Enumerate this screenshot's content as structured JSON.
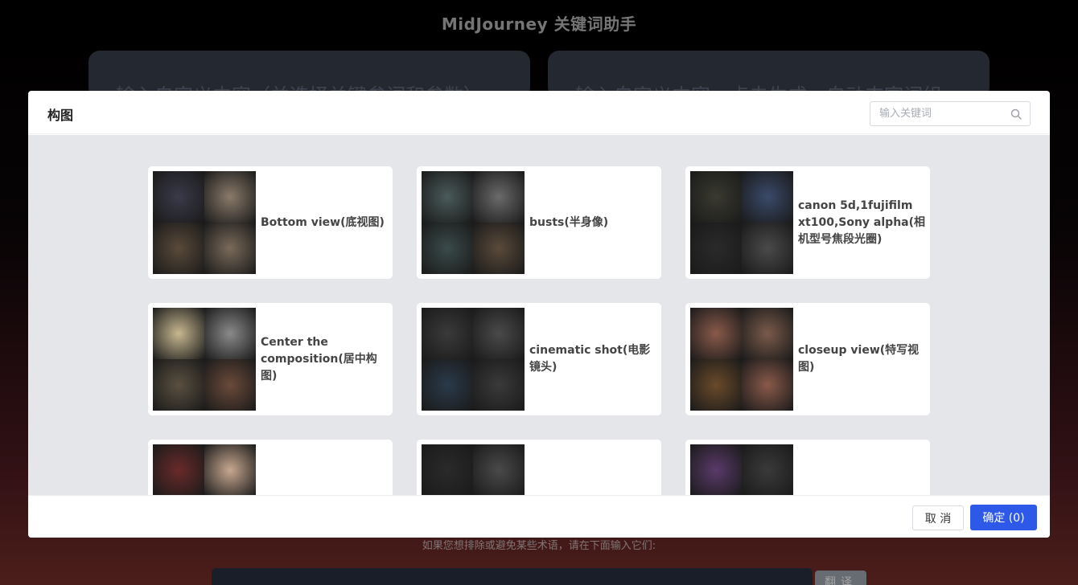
{
  "page": {
    "title": "MidJourney 关键词助手",
    "panel_left_text": "输入自定义内容（并选择关键参词和参数）",
    "panel_right_text": "输入自定义内容，点击生成，自动丰富词组",
    "exclude_hint": "如果您想排除或避免某些术语，请在下面输入它们:",
    "translate_label": "翻译"
  },
  "modal": {
    "title": "构图",
    "search_placeholder": "输入关键词",
    "cancel_label": "取 消",
    "confirm_label": "确定 (0)",
    "accent_color": "#2e58e8",
    "items": [
      {
        "label": "Bottom view(底视图)",
        "colors": [
          "#3a3a4a",
          "#8a7a6a",
          "#5a4a3a",
          "#7a6a5a"
        ]
      },
      {
        "label": "busts(半身像)",
        "colors": [
          "#4a5a5a",
          "#6a6a6a",
          "#3a4a4a",
          "#5a4a3a"
        ]
      },
      {
        "label": "canon 5d,1fujifilm xt100,Sony alpha(相机型号焦段光圈)",
        "colors": [
          "#3a3a30",
          "#3a4a6a",
          "#2a2a2a",
          "#4a4a4a"
        ]
      },
      {
        "label": "Center the composition(居中构图)",
        "colors": [
          "#c8b890",
          "#8a8a8a",
          "#5a5040",
          "#6a4a3a"
        ]
      },
      {
        "label": "cinematic shot(电影镜头)",
        "colors": [
          "#3a3a3a",
          "#4a4a4a",
          "#2a3a4a",
          "#3a3a3a"
        ]
      },
      {
        "label": "closeup view(特写视图)",
        "colors": [
          "#8a5a4a",
          "#7a5a4a",
          "#6a4a2a",
          "#8a5a4a"
        ]
      },
      {
        "label": "",
        "colors": [
          "#6a2a2a",
          "#c8a890",
          "#5a2a2a",
          "#b89880"
        ]
      },
      {
        "label": "",
        "colors": [
          "#2a2a2a",
          "#4a4a4a",
          "#3a3a3a",
          "#5a5a5a"
        ]
      },
      {
        "label": "",
        "colors": [
          "#5a3a6a",
          "#3a3a3a",
          "#4a3a5a",
          "#3a3a3a"
        ]
      }
    ]
  }
}
